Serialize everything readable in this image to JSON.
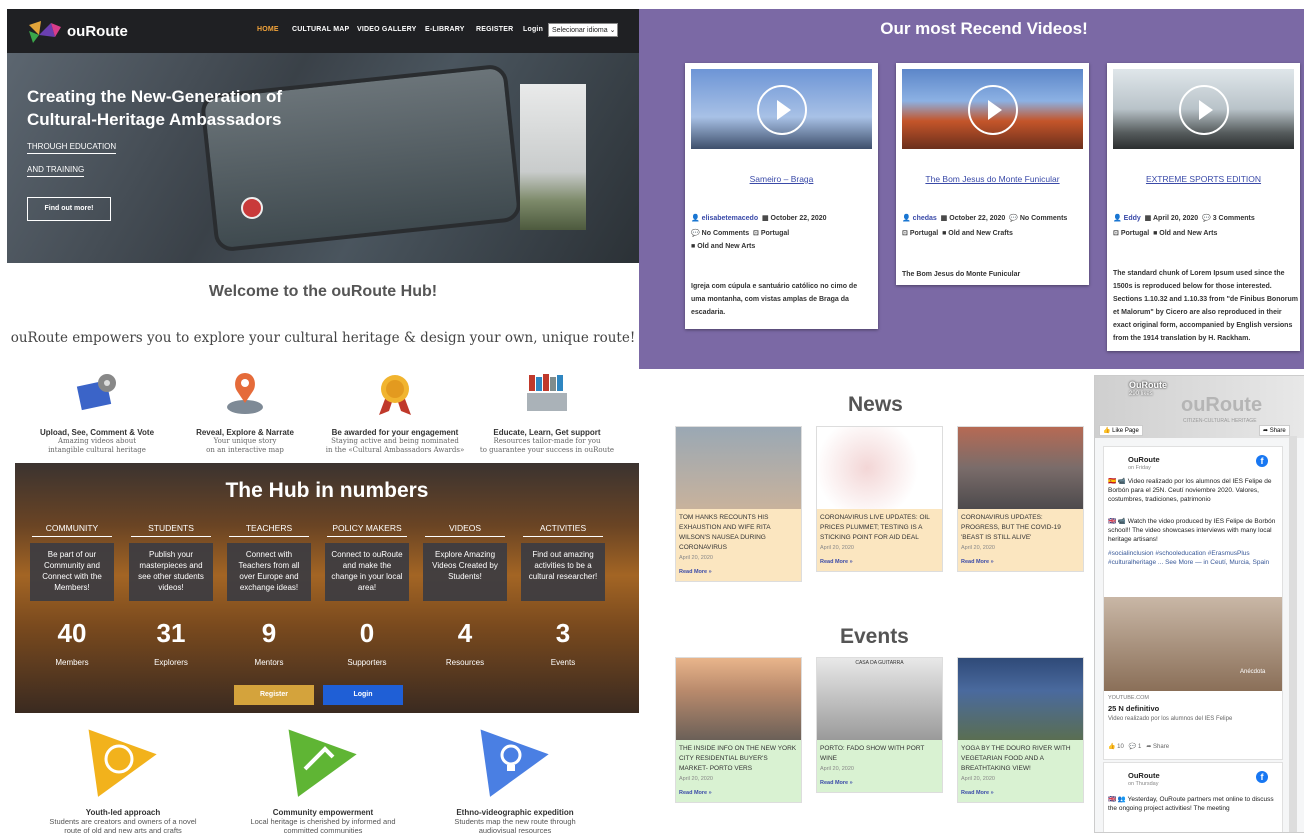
{
  "hub": {
    "brand": "ouRoute",
    "nav": [
      "HOME",
      "CULTURAL MAP",
      "VIDEO GALLERY",
      "E-LIBRARY",
      "REGISTER",
      "Login"
    ],
    "lang_select": "Selecionar idioma",
    "hero_title_1": "Creating the New-Generation of",
    "hero_title_2": "Cultural-Heritage Ambassadors",
    "hero_sub_1": "THROUGH EDUCATION",
    "hero_sub_2": "AND TRAINING",
    "hero_button": "Find out more!"
  },
  "welcome": {
    "title": "Welcome to the ouRoute Hub!",
    "tagline": "ouRoute empowers you to explore your cultural heritage & design your own, unique route!",
    "features": [
      {
        "title": "Upload, See, Comment & Vote",
        "l1": "Amazing videos about",
        "l2": "intangible cultural heritage"
      },
      {
        "title": "Reveal, Explore & Narrate",
        "l1": "Your unique story",
        "l2": "on an interactive map"
      },
      {
        "title": "Be awarded for your engagement",
        "l1": "Staying active and being nominated",
        "l2": "in the «Cultural Ambassadors Awards»"
      },
      {
        "title": "Educate, Learn, Get support",
        "l1": "Resources tailor-made for you",
        "l2": "to guarantee your success in ouRoute"
      }
    ]
  },
  "numbers": {
    "title": "The Hub in numbers",
    "cols": [
      {
        "cat": "COMMUNITY",
        "text": "Be part of our Community and Connect with the Members!",
        "num": "40",
        "label": "Members"
      },
      {
        "cat": "STUDENTS",
        "text": "Publish your masterpieces and see other students videos!",
        "num": "31",
        "label": "Explorers"
      },
      {
        "cat": "TEACHERS",
        "text": "Connect with Teachers from all over Europe and exchange ideas!",
        "num": "9",
        "label": "Mentors"
      },
      {
        "cat": "POLICY MAKERS",
        "text": "Connect to ouRoute and make the change in your local area!",
        "num": "0",
        "label": "Supporters"
      },
      {
        "cat": "VIDEOS",
        "text": "Explore Amazing Videos Created by Students!",
        "num": "4",
        "label": "Resources"
      },
      {
        "cat": "ACTIVITIES",
        "text": "Find out amazing activities to be a cultural researcher!",
        "num": "3",
        "label": "Events"
      }
    ],
    "register": "Register",
    "login": "Login"
  },
  "approach": [
    {
      "title": "Youth-led approach",
      "l1": "Students are creators and owners of a novel",
      "l2": "route of old and new arts and crafts"
    },
    {
      "title": "Community empowerment",
      "l1": "Local heritage is cherished by informed and",
      "l2": "committed communities"
    },
    {
      "title": "Ethno-videographic expedition",
      "l1": "Students map the new route through",
      "l2": "audiovisual resources"
    }
  ],
  "videos": {
    "title": "Our most Recend Videos!",
    "cards": [
      {
        "title": "Sameiro – Braga",
        "author": "elisabetemacedo",
        "date": "October 22, 2020",
        "comments": "No Comments",
        "country": "Portugal",
        "cat": "Old and New Arts",
        "desc": "Igreja com cúpula e santuário católico no cimo de uma montanha, com vistas amplas de Braga da escadaria."
      },
      {
        "title": "The Bom Jesus do Monte Funicular",
        "author": "chedas",
        "date": "October 22, 2020",
        "comments": "No Comments",
        "country": "Portugal",
        "cat": "Old and New Crafts",
        "desc": "The Bom Jesus do Monte Funicular"
      },
      {
        "title": "EXTREME SPORTS EDITION",
        "author": "Eddy",
        "date": "April 20, 2020",
        "comments": "3 Comments",
        "country": "Portugal",
        "cat": "Old and New Arts",
        "desc": "The standard chunk of Lorem Ipsum used since the 1500s is reproduced below for those interested. Sections 1.10.32 and 1.10.33 from \"de Finibus Bonorum et Malorum\" by Cicero are also reproduced in their exact original form, accompanied by English versions from the 1914 translation by H. Rackham."
      }
    ]
  },
  "news": {
    "title": "News",
    "items": [
      {
        "text": "TOM HANKS RECOUNTS HIS EXHAUSTION AND WIFE RITA WILSON'S NAUSEA DURING CORONAVIRUS",
        "date": "April 20, 2020",
        "more": "Read More »"
      },
      {
        "text": "CORONAVIRUS LIVE UPDATES: OIL PRICES PLUMMET; TESTING IS A STICKING POINT FOR AID DEAL",
        "date": "April 20, 2020",
        "more": "Read More »"
      },
      {
        "text": "CORONAVIRUS UPDATES: PROGRESS, BUT THE COVID-19 'BEAST IS STILL ALIVE'",
        "date": "April 20, 2020",
        "more": "Read More »"
      }
    ]
  },
  "events": {
    "title": "Events",
    "items": [
      {
        "text": "THE INSIDE INFO ON THE NEW YORK CITY RESIDENTIAL BUYER'S MARKET- PORTO VERS",
        "date": "April 20, 2020",
        "more": "Read More »"
      },
      {
        "text": "PORTO: FADO SHOW WITH PORT WINE",
        "date": "April 20, 2020",
        "more": "Read More »",
        "caption": "CASA DA GUITARRA"
      },
      {
        "text": "YOGA BY THE DOURO RIVER WITH VEGETARIAN FOOD AND A BREATHTAKING VIEW!",
        "date": "April 20, 2020",
        "more": "Read More »"
      }
    ]
  },
  "facebook": {
    "page_name": "OuRoute",
    "likes": "290 likes",
    "cover_title": "ouRoute",
    "cover_sub": "CITIZEN-CULTURAL HERITAGE",
    "like_btn": "Like Page",
    "share_btn": "Share",
    "post1": {
      "author": "OuRoute",
      "time": "on Friday",
      "text1": "🇪🇸 📹 Video realizado por los alumnos del IES Felipe de Borbón para el 25N. Ceutí noviembre 2020. Valores, costumbres, tradiciones, patrimonio",
      "text2": "🇬🇧 📹 Watch the video produced by IES Felipe de Borbón school!! The video showcases interviews with many local heritage artisans!",
      "tags": "#socialinclusion #schooleducation #ErasmusPlus #culturalheritage ... See More — in Ceutí, Murcia, Spain",
      "img_caption": "Anécdota",
      "link_src": "YOUTUBE.COM",
      "link_title": "25 N definitivo",
      "link_desc": "Video realizado por los alumnos del IES Felipe",
      "likes": "10",
      "comments": "1",
      "share": "Share"
    },
    "post2": {
      "author": "OuRoute",
      "time": "on Thursday",
      "text": "🇬🇧 👥 Yesterday, OuRoute partners met online to discuss the ongoing project activities! The meeting"
    }
  },
  "colors": {
    "accent": "#f2a33a",
    "purple": "#7b69a5",
    "link": "#3a4aa8",
    "register": "#d4a33c",
    "login": "#1f5fd6"
  }
}
